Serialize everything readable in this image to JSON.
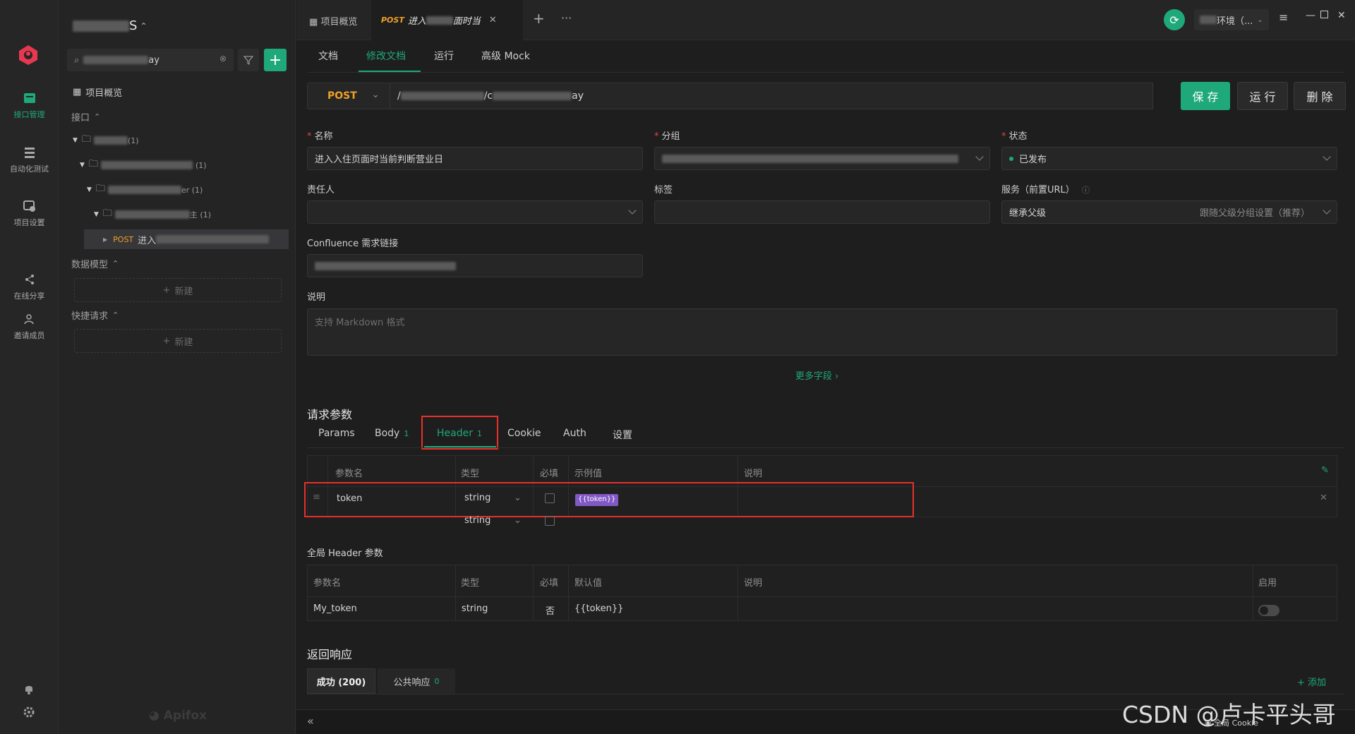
{
  "rail": {
    "items": [
      {
        "label": "接口管理"
      },
      {
        "label": "自动化测试"
      },
      {
        "label": "项目设置"
      },
      {
        "label": "在线分享"
      },
      {
        "label": "邀请成员"
      }
    ],
    "brand": "Apifox"
  },
  "sidebar": {
    "project_suffix": "S",
    "search_suffix": "ay",
    "overview_label": "项目概览",
    "interfaces_label": "接口",
    "tree": [
      {
        "suffix": "(1)"
      },
      {
        "suffix": "(1)"
      },
      {
        "suffix": "er (1)"
      },
      {
        "suffix": "主 (1)"
      }
    ],
    "active_method": "POST",
    "active_name": "进入",
    "data_model_label": "数据模型",
    "new_label": "新建",
    "quick_request_label": "快捷请求",
    "new_label2": "新建"
  },
  "tabs": {
    "overview": "项目概览",
    "active_method": "POST",
    "active_title_a": "进入",
    "active_title_b": "面时当",
    "env_label": "环境（..."
  },
  "doc_tabs": [
    "文档",
    "修改文档",
    "运行",
    "高级 Mock"
  ],
  "request": {
    "method": "POST",
    "url_start": "/",
    "url_mid": "/c",
    "url_end": "ay",
    "save": "保 存",
    "run": "运 行",
    "delete": "删 除"
  },
  "form": {
    "name_label": "名称",
    "name_value": "进入入住页面时当前判断营业日",
    "group_label": "分组",
    "status_label": "状态",
    "status_value": "已发布",
    "owner_label": "责任人",
    "tags_label": "标签",
    "service_label": "服务（前置URL）",
    "service_value": "继承父级",
    "service_hint": "跟随父级分组设置（推荐）",
    "confluence_label": "Confluence 需求链接",
    "desc_label": "说明",
    "desc_placeholder": "支持 Markdown 格式",
    "more_fields": "更多字段 ›"
  },
  "params": {
    "title": "请求参数",
    "tabs": [
      {
        "label": "Params",
        "count": ""
      },
      {
        "label": "Body",
        "count": "1"
      },
      {
        "label": "Header",
        "count": "1"
      },
      {
        "label": "Cookie",
        "count": ""
      },
      {
        "label": "Auth",
        "count": ""
      },
      {
        "label": "设置",
        "count": ""
      }
    ],
    "headers": [
      "参数名",
      "类型",
      "必填",
      "示例值",
      "说明"
    ],
    "rows": [
      {
        "name": "token",
        "type": "string",
        "example": "{{token}}"
      },
      {
        "name": "",
        "type": "string",
        "example": ""
      }
    ]
  },
  "global_header": {
    "title": "全局 Header 参数",
    "headers": [
      "参数名",
      "类型",
      "必填",
      "默认值",
      "说明",
      "启用"
    ],
    "rows": [
      {
        "name": "My_token",
        "type": "string",
        "required": "否",
        "default": "{{token}}"
      }
    ]
  },
  "response": {
    "title": "返回响应",
    "tab_success": "成功 (200)",
    "tab_common": "公共响应",
    "tab_common_count": "0",
    "add": "+ 添加"
  },
  "footer": {
    "global_cookie": "全局 Cookie",
    "watermark": "CSDN @卢卡平头哥"
  },
  "colors": {
    "accent": "#1fa97a",
    "post": "#f0a028",
    "highlight": "#e8302a"
  }
}
